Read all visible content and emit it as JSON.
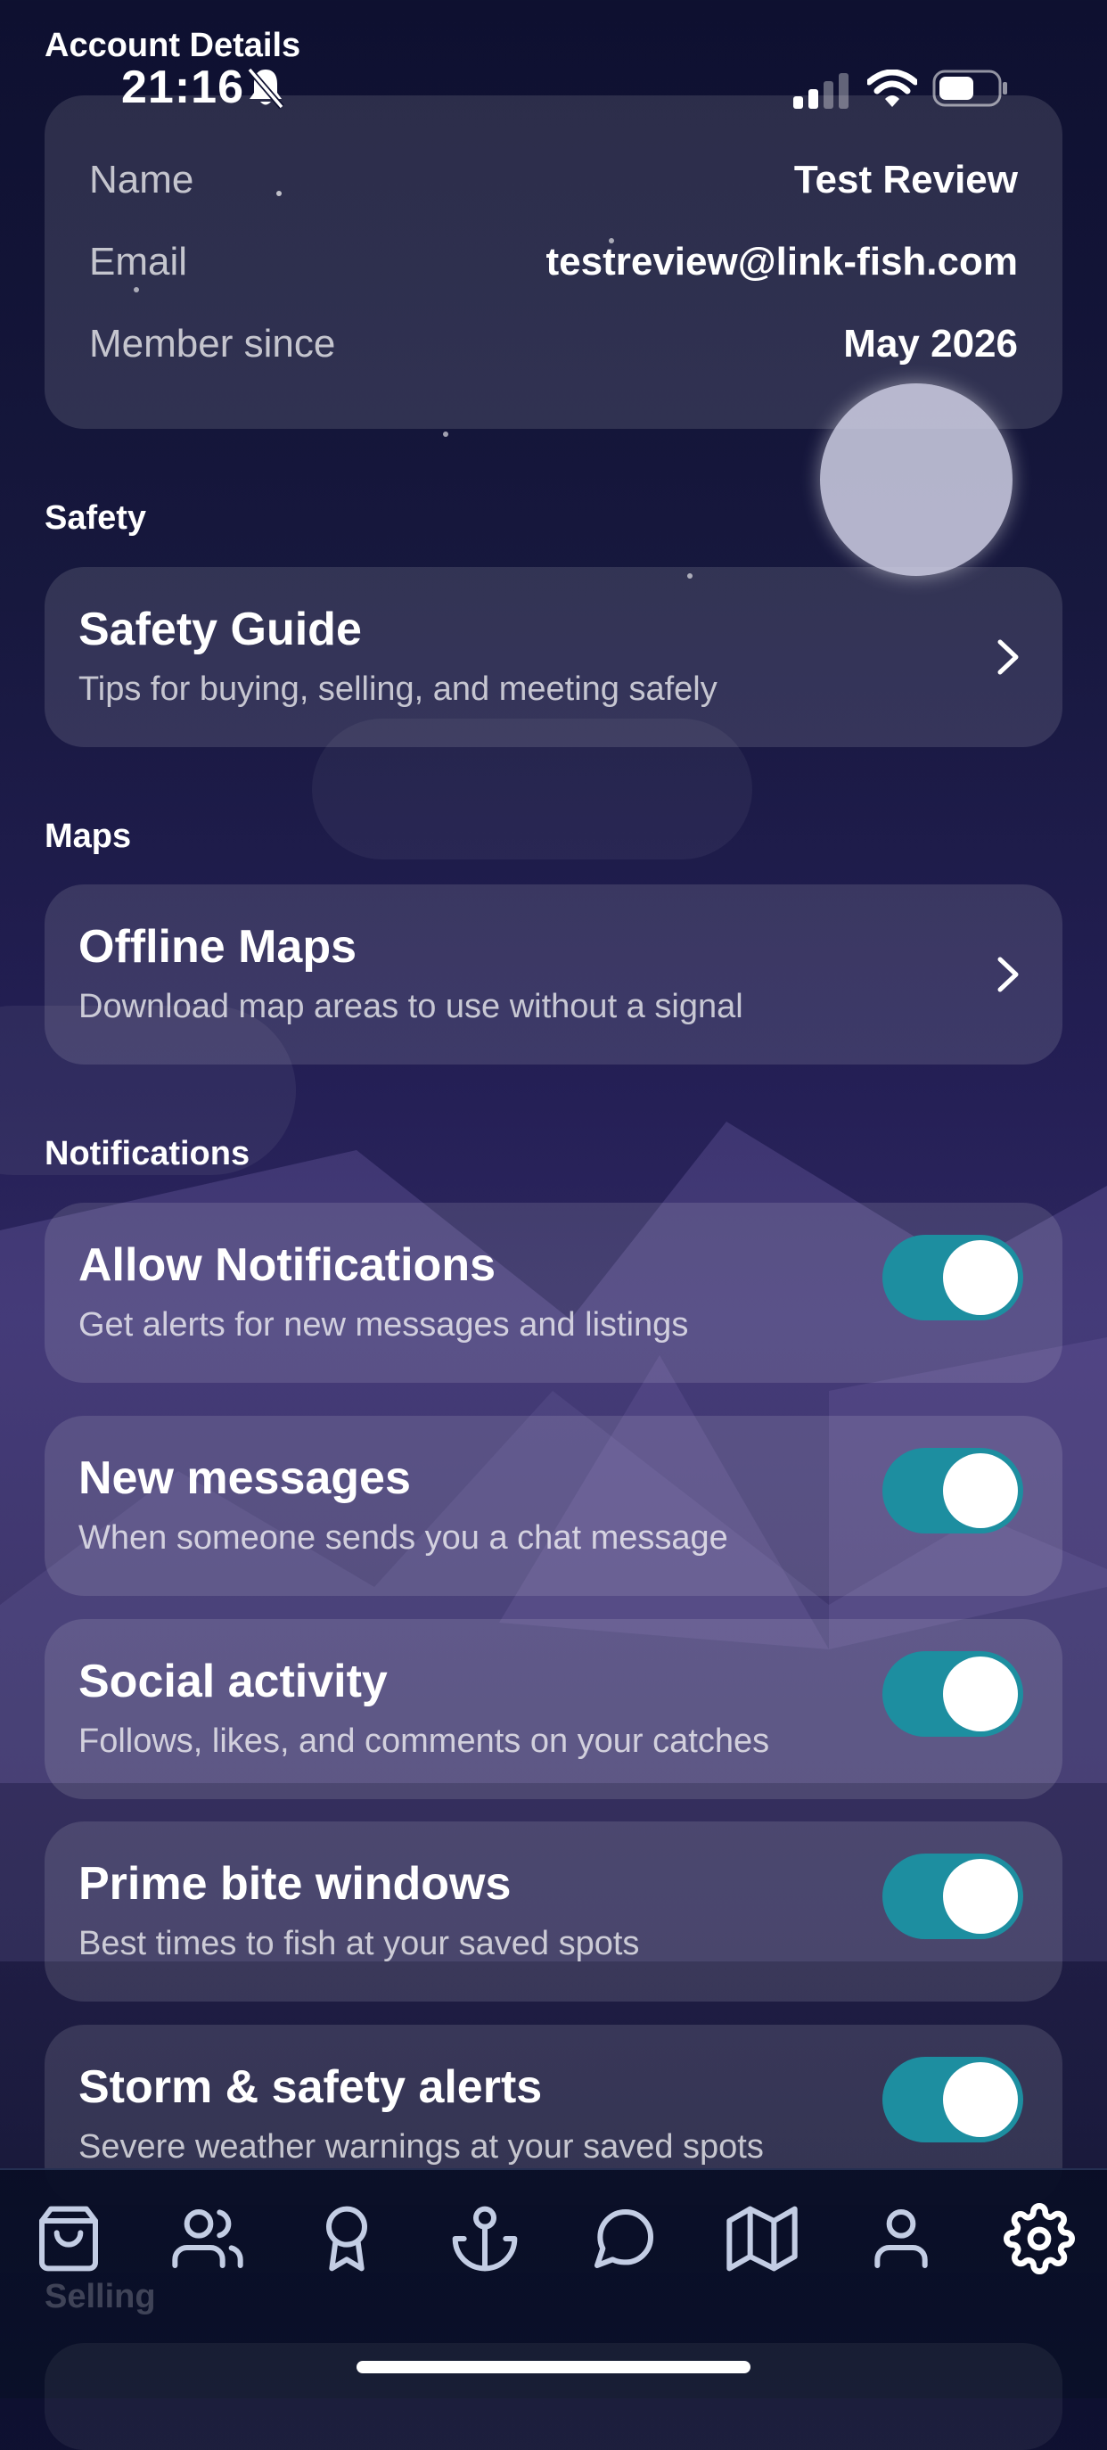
{
  "status_bar": {
    "time": "21:16"
  },
  "account": {
    "heading": "Account Details",
    "rows": [
      {
        "label": "Name",
        "value": "Test Review"
      },
      {
        "label": "Email",
        "value": "testreview@link-fish.com"
      },
      {
        "label": "Member since",
        "value": "May 2026"
      }
    ]
  },
  "safety": {
    "section_label": "Safety",
    "item": {
      "title": "Safety Guide",
      "subtitle": "Tips for buying, selling, and meeting safely"
    }
  },
  "maps": {
    "section_label": "Maps",
    "item": {
      "title": "Offline Maps",
      "subtitle": "Download map areas to use without a signal"
    }
  },
  "notifications": {
    "section_label": "Notifications",
    "items": [
      {
        "title": "Allow Notifications",
        "subtitle": "Get alerts for new messages and listings",
        "enabled": true
      },
      {
        "title": "New messages",
        "subtitle": "When someone sends you a chat message",
        "enabled": true
      },
      {
        "title": "Social activity",
        "subtitle": "Follows, likes, and comments on your catches",
        "enabled": true
      },
      {
        "title": "Prime bite windows",
        "subtitle": "Best times to fish at your saved spots",
        "enabled": true
      },
      {
        "title": "Storm & safety alerts",
        "subtitle": "Severe weather warnings at your saved spots",
        "enabled": true
      }
    ]
  },
  "selling": {
    "section_label": "Selling"
  },
  "tab_bar": {
    "tabs": [
      {
        "icon": "shopping-bag-icon",
        "active": false
      },
      {
        "icon": "users-icon",
        "active": false
      },
      {
        "icon": "award-icon",
        "active": false
      },
      {
        "icon": "anchor-icon",
        "active": false
      },
      {
        "icon": "chat-icon",
        "active": false
      },
      {
        "icon": "map-icon",
        "active": false
      },
      {
        "icon": "profile-icon",
        "active": false
      },
      {
        "icon": "gear-icon",
        "active": true
      }
    ]
  },
  "colors": {
    "toggle_on": "#1d8ea0",
    "tab_icon": "#c3cde4",
    "tab_icon_active": "#ffffff"
  }
}
